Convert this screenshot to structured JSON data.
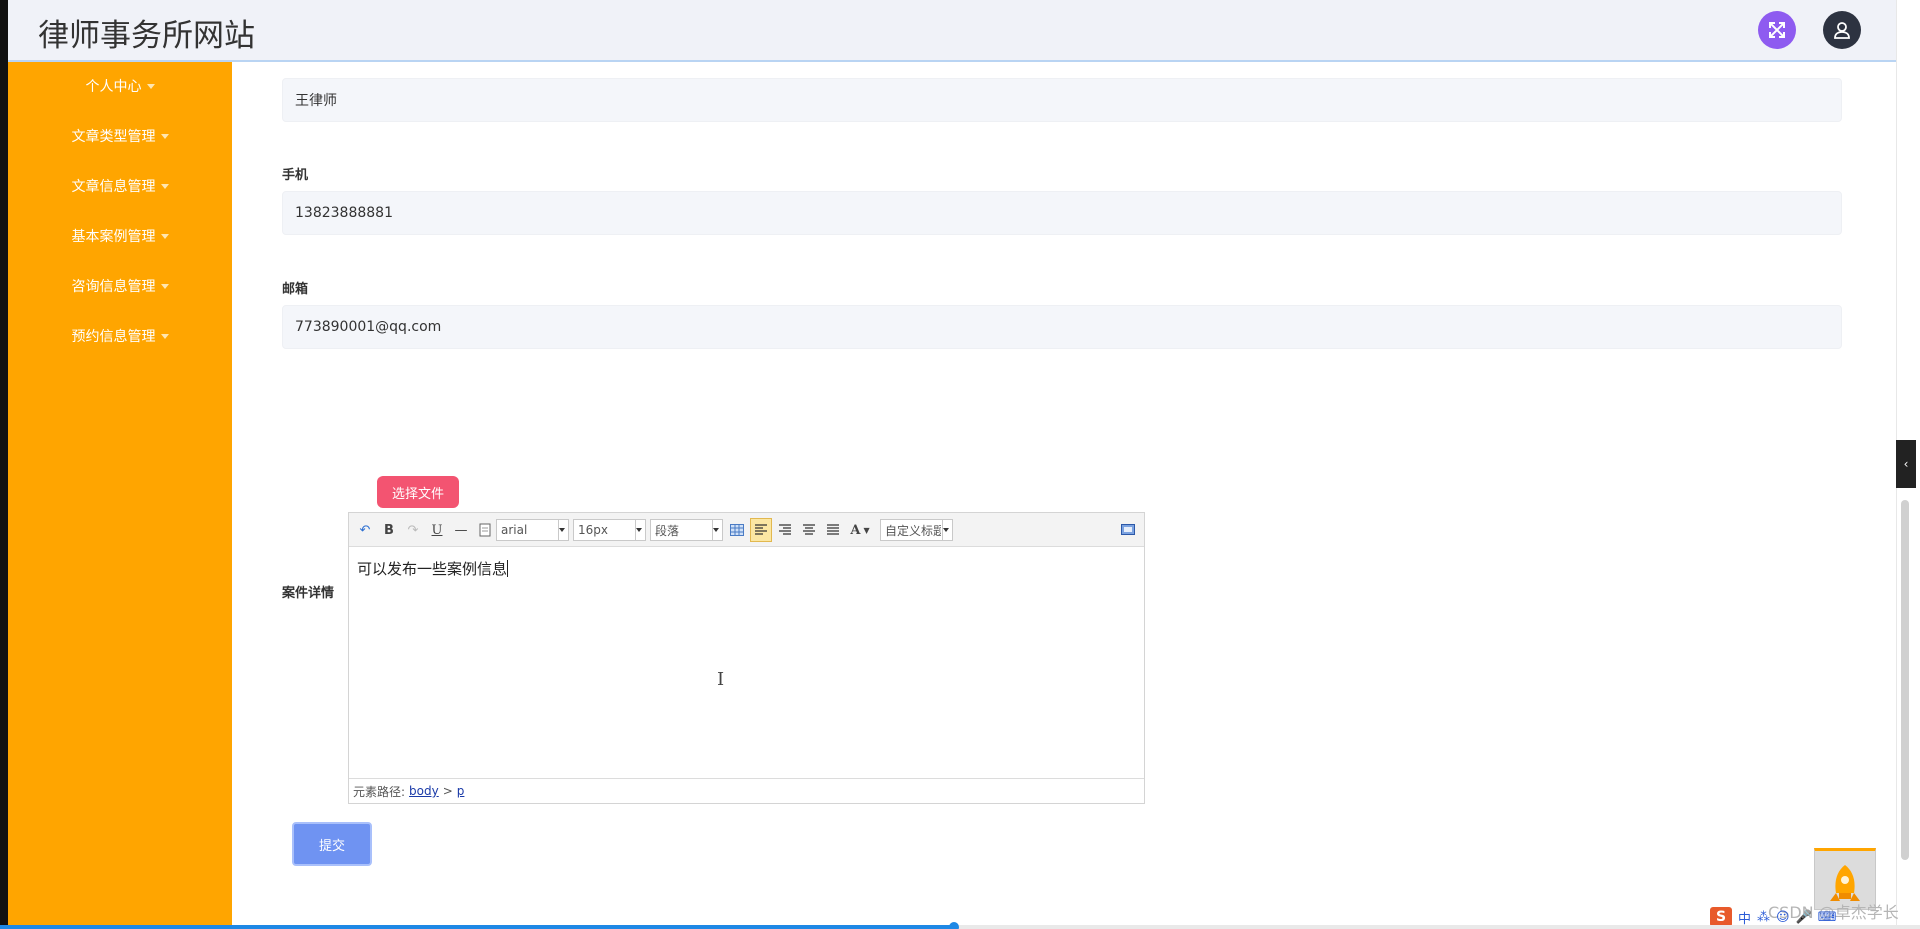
{
  "header": {
    "title": "律师事务所网站",
    "fullscreen_icon": "expand-arrows-icon",
    "user_icon": "user-avatar-icon"
  },
  "sidebar": {
    "items": [
      {
        "label": "个人中心"
      },
      {
        "label": "文章类型管理"
      },
      {
        "label": "文章信息管理"
      },
      {
        "label": "基本案例管理"
      },
      {
        "label": "咨询信息管理"
      },
      {
        "label": "预约信息管理"
      }
    ]
  },
  "form": {
    "name_value": "王律师",
    "phone_label": "手机",
    "phone_value": "13823888881",
    "email_label": "邮箱",
    "email_value": "773890001@qq.com",
    "detail_label": "案件详情",
    "choose_file_label": "选择文件",
    "submit_label": "提交"
  },
  "editor": {
    "font_family": "arial",
    "font_size": "16px",
    "paragraph": "段落",
    "custom_title": "自定义标题",
    "font_color_glyph": "A",
    "content": "可以发布一些案例信息",
    "path_label": "元素路径:",
    "path_body": "body",
    "path_sep": ">",
    "path_p": "p"
  },
  "watermark": {
    "text": "CSDN @卓杰学长"
  },
  "tray": {
    "logo_glyph": "S",
    "ime_label": "中"
  },
  "progress": {
    "fraction": 0.497
  },
  "colors": {
    "sidebar": "#ffa500",
    "fullscreen_button": "#8e5bf0",
    "user_button": "#2d3341",
    "choose_file_button": "#f35471",
    "submit_button": "#6f93f2",
    "progress": "#1e88e5"
  }
}
